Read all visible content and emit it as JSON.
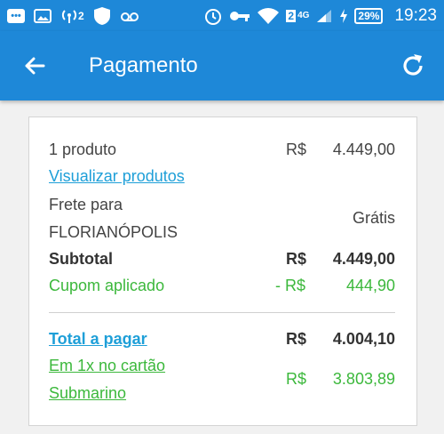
{
  "status": {
    "badge": "2",
    "network": "4G",
    "network_level": "2",
    "battery": "29%",
    "time": "19:23"
  },
  "header": {
    "title": "Pagamento"
  },
  "summary": {
    "products_label": "1 produto",
    "products_currency": "R$",
    "products_amount": "4.449,00",
    "view_products_link": "Visualizar produtos",
    "shipping_label_1": "Frete para",
    "shipping_label_2": "FLORIANÓPOLIS",
    "shipping_value": "Grátis",
    "subtotal_label": "Subtotal",
    "subtotal_currency": "R$",
    "subtotal_amount": "4.449,00",
    "coupon_label": "Cupom aplicado",
    "coupon_currency": "- R$",
    "coupon_amount": "444,90",
    "total_label": "Total a pagar",
    "total_currency": "R$",
    "total_amount": "4.004,10",
    "card_label_1": "Em 1x no cartão",
    "card_label_2": "Submarino",
    "card_currency": "R$",
    "card_amount": "3.803,89"
  },
  "colors": {
    "primary": "#1e88d8",
    "green": "#3cb83c",
    "link": "#1e9fd8"
  }
}
